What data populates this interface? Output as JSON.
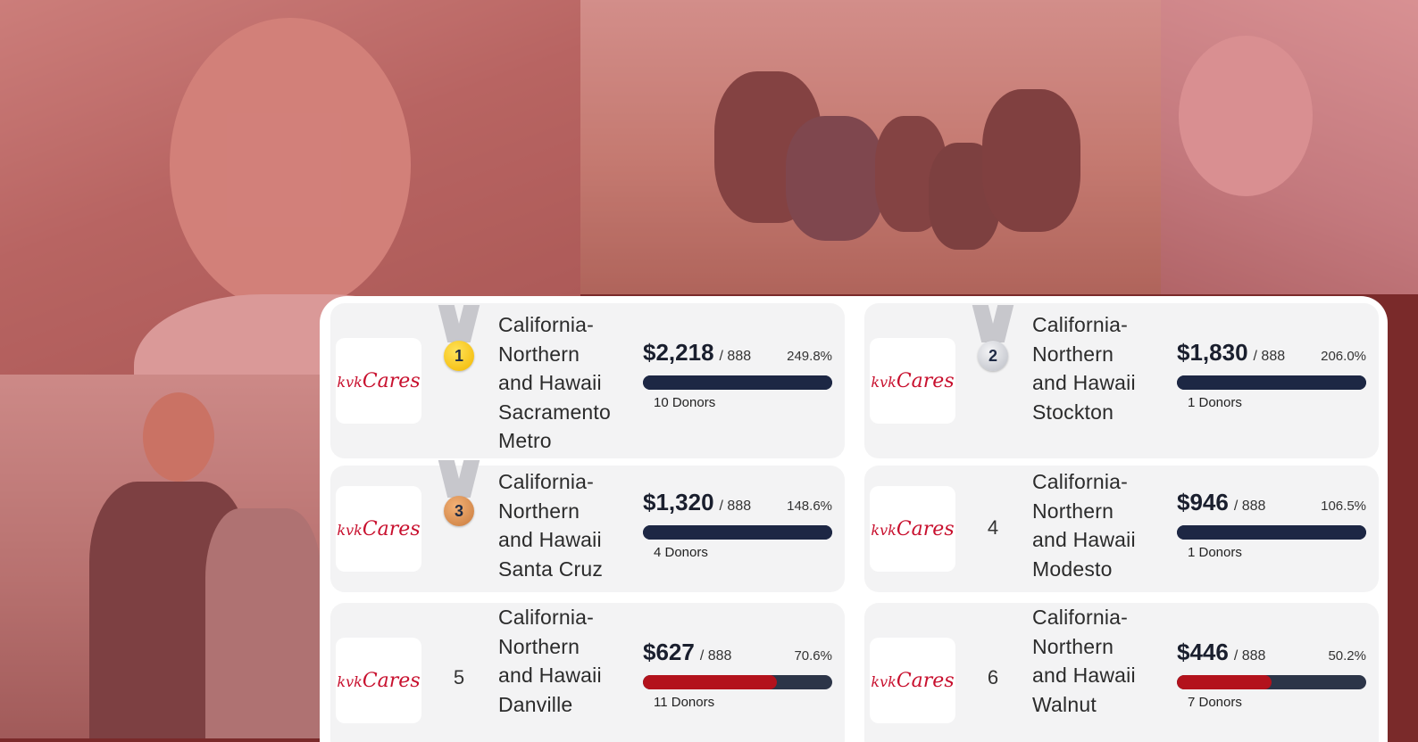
{
  "leaderboard": [
    {
      "rank": 1,
      "medal": "gold",
      "logo_pre": "kvk",
      "logo_main": "Cares",
      "name_lines": [
        "California-",
        "Northern",
        "and Hawaii",
        "Sacramento",
        "Metro"
      ],
      "amount": "$2,218",
      "goal": "888",
      "percent": "249.8%",
      "progress": 1.0,
      "bar_color": "navy",
      "donors": "10 Donors"
    },
    {
      "rank": 2,
      "medal": "silver",
      "logo_pre": "kvk",
      "logo_main": "Cares",
      "name_lines": [
        "California-",
        "Northern",
        "and Hawaii",
        "Stockton"
      ],
      "amount": "$1,830",
      "goal": "888",
      "percent": "206.0%",
      "progress": 1.0,
      "bar_color": "navy",
      "donors": "1 Donors"
    },
    {
      "rank": 3,
      "medal": "bronze",
      "logo_pre": "kvk",
      "logo_main": "Cares",
      "name_lines": [
        "California-",
        "Northern",
        "and Hawaii",
        "Santa Cruz"
      ],
      "amount": "$1,320",
      "goal": "888",
      "percent": "148.6%",
      "progress": 1.0,
      "bar_color": "navy",
      "donors": "4 Donors"
    },
    {
      "rank": 4,
      "medal": "",
      "logo_pre": "kvk",
      "logo_main": "Cares",
      "name_lines": [
        "California-",
        "Northern",
        "and Hawaii",
        "Modesto"
      ],
      "amount": "$946",
      "goal": "888",
      "percent": "106.5%",
      "progress": 1.0,
      "bar_color": "navy",
      "donors": "1 Donors"
    },
    {
      "rank": 5,
      "medal": "",
      "logo_pre": "kvk",
      "logo_main": "Cares",
      "name_lines": [
        "California-",
        "Northern",
        "and Hawaii",
        "Danville"
      ],
      "amount": "$627",
      "goal": "888",
      "percent": "70.6%",
      "progress": 0.706,
      "bar_color": "red",
      "donors": "11 Donors"
    },
    {
      "rank": 6,
      "medal": "",
      "logo_pre": "kvk",
      "logo_main": "Cares",
      "name_lines": [
        "California-",
        "Northern",
        "and Hawaii",
        "Walnut"
      ],
      "amount": "$446",
      "goal": "888",
      "percent": "50.2%",
      "progress": 0.502,
      "bar_color": "red",
      "donors": "7 Donors"
    }
  ],
  "colors": {
    "navy": "#1d2744",
    "red": "#b3121c",
    "tint": "#cd5f5f"
  }
}
